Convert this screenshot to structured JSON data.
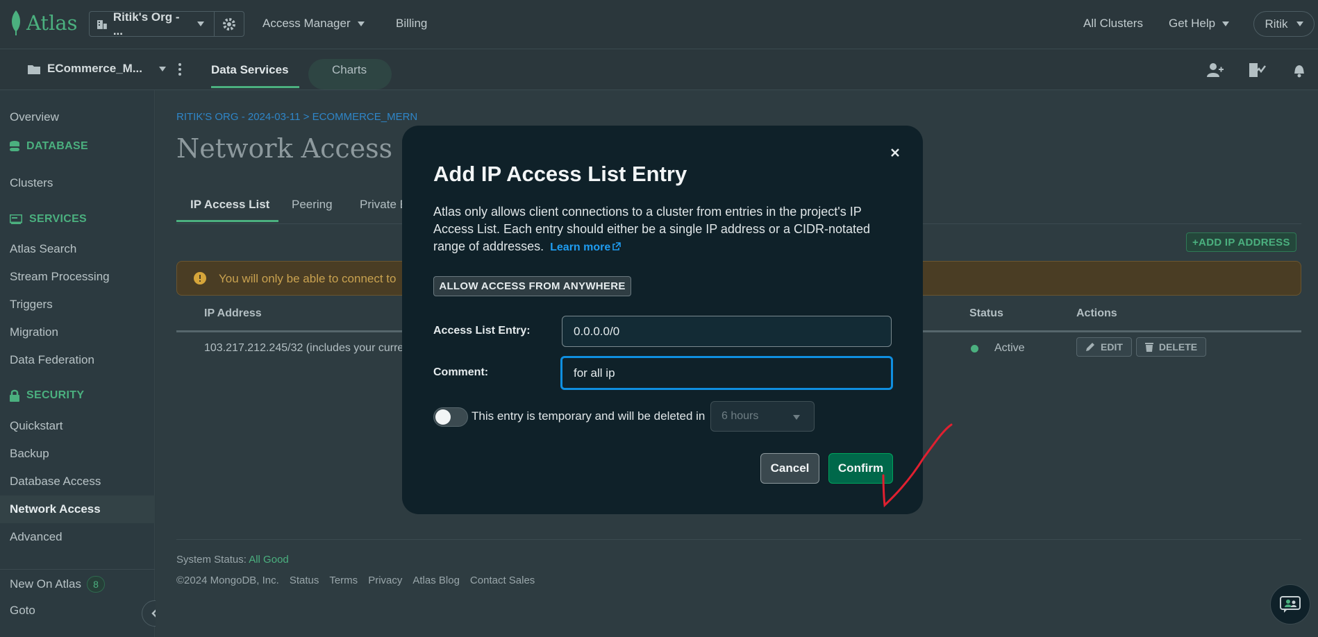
{
  "topbar": {
    "brand": "Atlas",
    "org_name": "Ritik's Org - ...",
    "access_manager": "Access Manager",
    "billing": "Billing",
    "all_clusters": "All Clusters",
    "get_help": "Get Help",
    "user": "Ritik"
  },
  "subbar": {
    "project": "ECommerce_M...",
    "data_services": "Data Services",
    "charts": "Charts"
  },
  "sidebar": {
    "overview": "Overview",
    "database_head": "DATABASE",
    "clusters": "Clusters",
    "services_head": "SERVICES",
    "atlas_search": "Atlas Search",
    "stream_processing": "Stream Processing",
    "triggers": "Triggers",
    "migration": "Migration",
    "data_federation": "Data Federation",
    "security_head": "SECURITY",
    "quickstart": "Quickstart",
    "backup": "Backup",
    "database_access": "Database Access",
    "network_access": "Network Access",
    "advanced": "Advanced",
    "new_on_atlas": "New On Atlas",
    "new_count": "8",
    "goto": "Goto"
  },
  "main": {
    "breadcrumb": "RITIK'S ORG - 2024-03-11 > ECOMMERCE_MERN",
    "title": "Network Access",
    "tabs": [
      "IP Access List",
      "Peering",
      "Private E"
    ],
    "add_ip_button": "+ADD IP ADDRESS",
    "warning": "You will only be able to connect to",
    "columns": {
      "ip": "IP Address",
      "status": "Status",
      "actions": "Actions"
    },
    "row": {
      "ip": "103.217.212.245/32  (includes your curre",
      "status": "Active",
      "edit": "EDIT",
      "delete": "DELETE"
    }
  },
  "footer": {
    "system_status_label": "System Status:",
    "system_status_value": "All Good",
    "copyright": "©2024 MongoDB, Inc.",
    "links": [
      "Status",
      "Terms",
      "Privacy",
      "Atlas Blog",
      "Contact Sales"
    ]
  },
  "modal": {
    "title": "Add IP Access List Entry",
    "description": "Atlas only allows client connections to a cluster from entries in the project's IP Access List. Each entry should either be a single IP address or a CIDR-notated range of addresses.",
    "learn_more": "Learn more",
    "allow_anywhere": "ALLOW ACCESS FROM ANYWHERE",
    "entry_label": "Access List Entry:",
    "entry_value": "0.0.0.0/0",
    "comment_label": "Comment:",
    "comment_value": "for all ip",
    "temporary_text": "This entry is temporary and will be deleted in",
    "duration_value": "6 hours",
    "cancel": "Cancel",
    "confirm": "Confirm"
  },
  "colors": {
    "brand_green": "#4bb07f",
    "link_blue": "#1f9cf0",
    "confirm_green": "#00684a",
    "focus_blue": "#0f8fe0",
    "annotation_red": "#e02030"
  },
  "icons": [
    "leaf-icon",
    "building-icon",
    "gear-icon",
    "folder-icon",
    "kebab-icon",
    "database-icon",
    "services-icon",
    "lock-icon",
    "warning-icon",
    "pencil-icon",
    "trash-icon",
    "external-link-icon",
    "close-icon",
    "add-user-icon",
    "activity-icon",
    "bell-icon",
    "chevron-left-icon",
    "chat-icon"
  ]
}
